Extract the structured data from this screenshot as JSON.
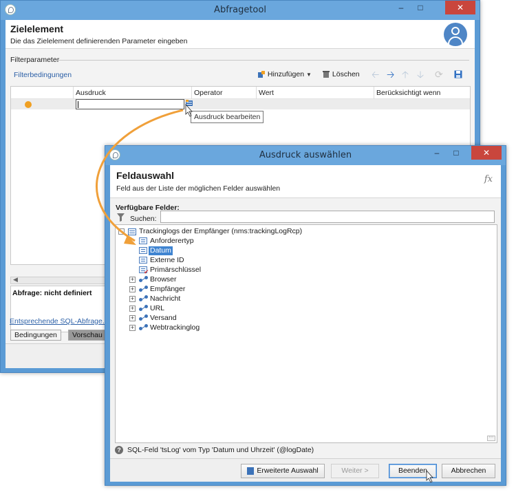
{
  "window1": {
    "title": "Abfragetool",
    "header_title": "Zielelement",
    "header_subtitle": "Die das Zielelement definierenden Parameter eingeben",
    "section_label": "Filterparameter",
    "filter_link": "Filterbedingungen",
    "toolbar": {
      "add_label": "Hinzufügen",
      "delete_label": "Löschen"
    },
    "grid": {
      "columns": [
        "Ausdruck",
        "Operator",
        "Wert",
        "Berücksichtigt wenn"
      ]
    },
    "tooltip": "Ausdruck bearbeiten",
    "query_status": "Abfrage: nicht definiert",
    "sql_link": "Entsprechende SQL-Abfrage...",
    "tabs": [
      "Bedingungen",
      "Vorschau"
    ]
  },
  "window2": {
    "title": "Ausdruck auswählen",
    "header_title": "Feldauswahl",
    "header_subtitle": "Feld aus der Liste der möglichen Felder auswählen",
    "fx_label": "fx",
    "available_fields_label": "Verfügbare Felder:",
    "search_label": "Suchen:",
    "search_value": "",
    "tree": {
      "root": "Trackinglogs der Empfänger (nms:trackingLogRcp)",
      "fields": [
        "Anforderertyp",
        "Datum",
        "Externe ID",
        "Primärschlüssel"
      ],
      "selected": "Datum",
      "links": [
        "Browser",
        "Empfänger",
        "Nachricht",
        "URL",
        "Versand",
        "Webtrackinglog"
      ]
    },
    "info_text": "SQL-Feld 'tsLog' vom Typ 'Datum und Uhrzeit' (@logDate)",
    "buttons": {
      "advanced": "Erweiterte Auswahl",
      "next": "Weiter >",
      "finish": "Beenden",
      "cancel": "Abbrechen"
    }
  },
  "colors": {
    "titlebar": "#6aa7dd",
    "close": "#c9463d",
    "accent_link": "#2b5fa6",
    "selection": "#3f84d1",
    "callout_arrow": "#f0a03a"
  }
}
